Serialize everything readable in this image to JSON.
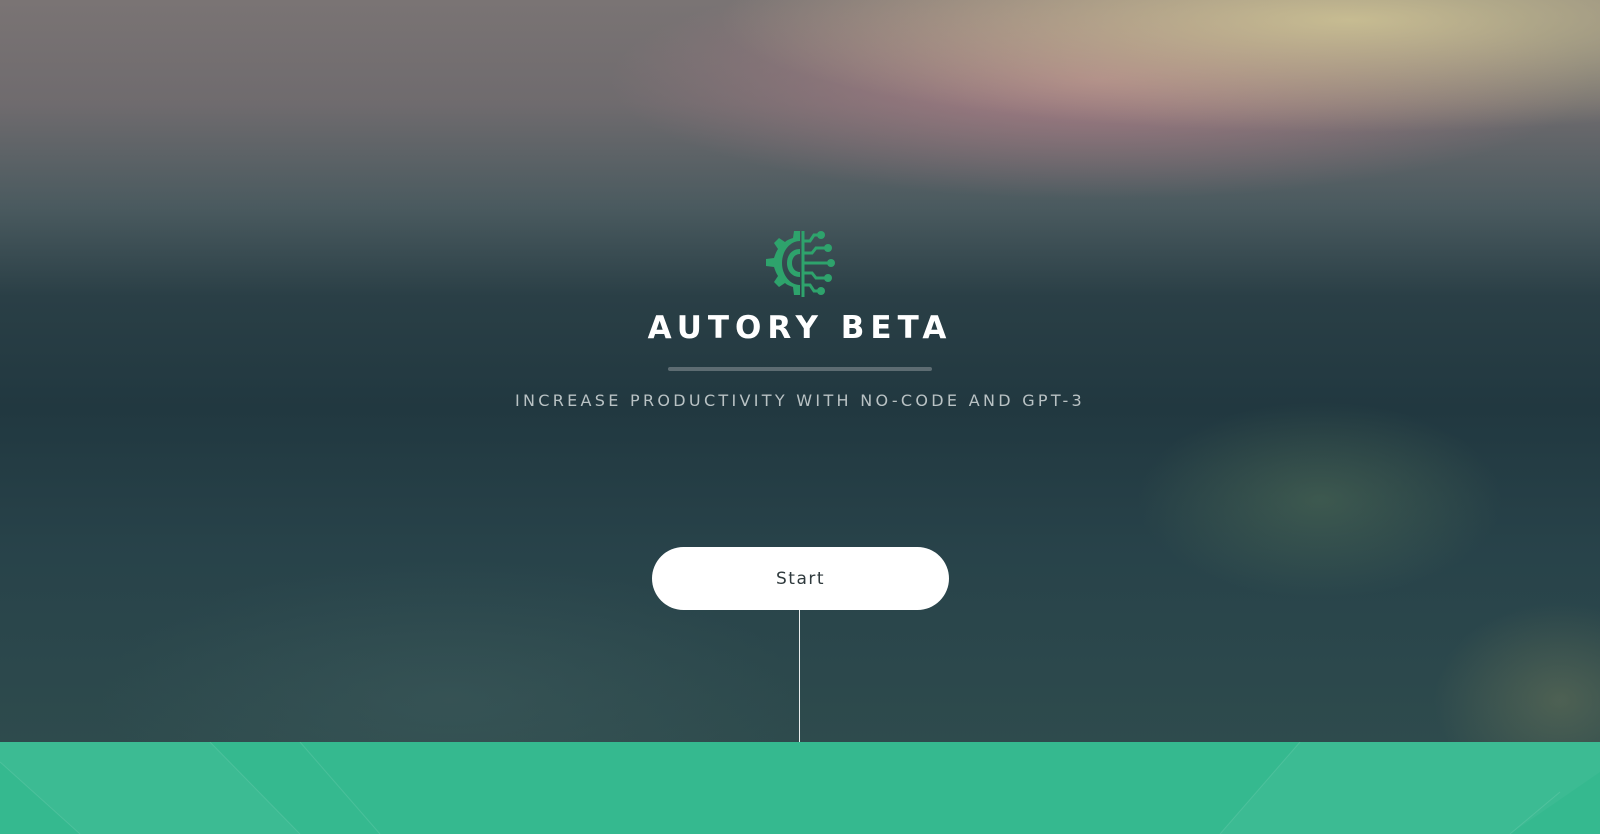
{
  "hero": {
    "title": "AUTORY BETA",
    "subtitle": "INCREASE PRODUCTIVITY WITH NO-CODE AND GPT-3",
    "logo_icon": "gear-circuit-icon",
    "start_label": "Start"
  },
  "colors": {
    "accent": "#35b98f",
    "logo": "#2ea36c",
    "button_bg": "#ffffff",
    "title": "#ffffff"
  }
}
